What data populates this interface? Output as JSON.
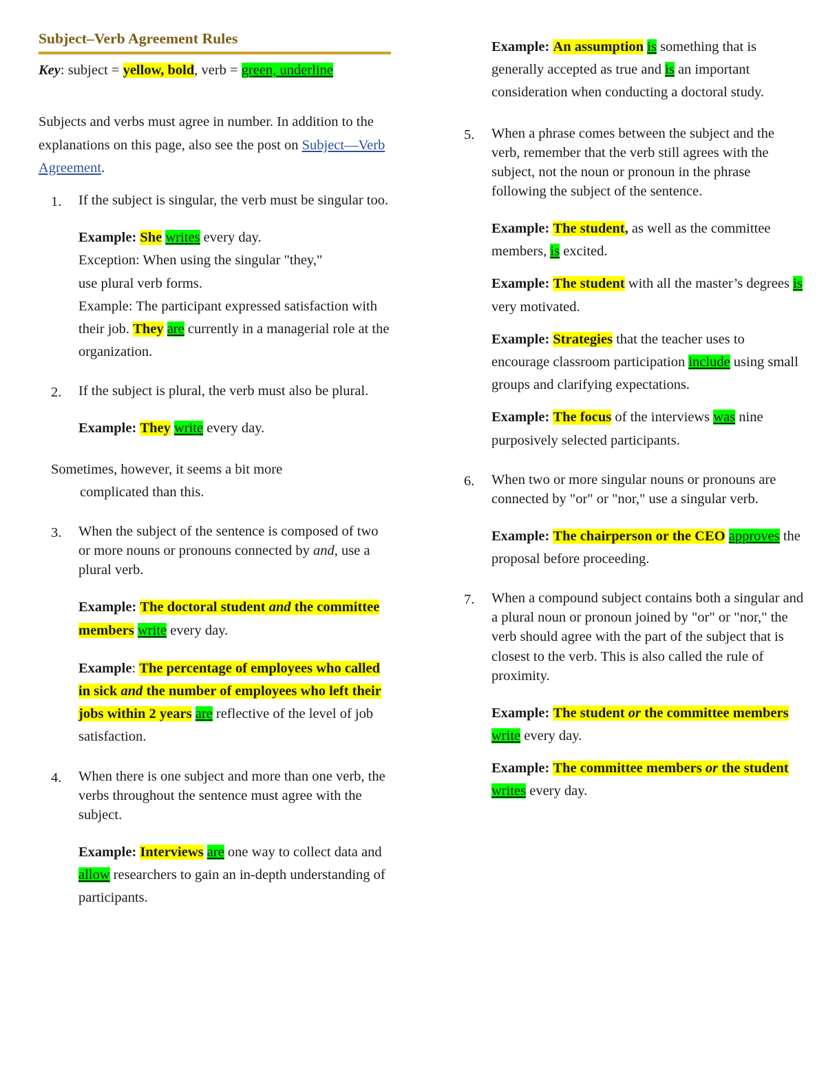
{
  "document": {
    "title": "Subject–Verb Agreement Rules",
    "accent_rule_color": "#cf9f28",
    "title_color": "#7a5c12",
    "subject_highlight_color": "#FFFF00",
    "verb_highlight_color": "#00FF00",
    "link_color": "#2b4f9e"
  },
  "key": {
    "label": "Key",
    "text_before": ": subject = ",
    "subject_sample": "yellow, bold",
    "text_middle": ", verb = ",
    "verb_sample": "green, underline"
  },
  "intro": {
    "line1": "Subjects and verbs must agree in number. In addition",
    "line2": "to the explanations on this page, also see the post",
    "line3_prefix": "on ",
    "link_text": "Subject—Verb Agreement",
    "line3_suffix": "."
  },
  "rules": [
    {
      "number": "1.",
      "text": "If the subject is singular, the verb must be singular too.",
      "examples": [
        {
          "label": "Example:",
          "parts": [
            {
              "t": "She",
              "style": "subject"
            },
            {
              "t": " ",
              "style": "plain"
            },
            {
              "t": "writes",
              "style": "verb"
            },
            {
              "t": " every day.",
              "style": "plain"
            }
          ]
        }
      ],
      "exception_lines": [
        "Exception: When using the singular \"they,\"",
        "use plural verb forms."
      ],
      "exception_example": {
        "label": "Example:",
        "parts": [
          {
            "t": " The participant expressed satisfaction with their job. ",
            "style": "plain"
          },
          {
            "t": "They",
            "style": "subject"
          },
          {
            "t": " ",
            "style": "plain"
          },
          {
            "t": "are",
            "style": "verb"
          },
          {
            "t": " currently in a managerial role at the organization.",
            "style": "plain"
          }
        ]
      }
    },
    {
      "number": "2.",
      "text": "If the subject is plural, the verb must also be plural.",
      "examples": [
        {
          "label": "Example:",
          "parts": [
            {
              "t": "They",
              "style": "subject"
            },
            {
              "t": " ",
              "style": "plain"
            },
            {
              "t": "write",
              "style": "verb"
            },
            {
              "t": " every day.",
              "style": "plain"
            }
          ]
        }
      ]
    },
    {
      "number": "3.",
      "text_a": "When the subject of the sentence is composed of two or more nouns or pronouns connected by ",
      "text_italic": "and",
      "text_b": ", use a plural verb.",
      "examples": [
        {
          "label": "Example:",
          "parts": [
            {
              "t": "The doctoral student ",
              "style": "subject"
            },
            {
              "t": "and",
              "style": "subject-italic"
            },
            {
              "t": " the ",
              "style": "subject"
            },
            {
              "t": "committee members",
              "style": "subject"
            },
            {
              "t": " ",
              "style": "plain"
            },
            {
              "t": "write",
              "style": "verb"
            },
            {
              "t": " every day.",
              "style": "plain"
            }
          ]
        },
        {
          "label": "Example",
          "label_suffix": ":",
          "parts": [
            {
              "t": "The percentage of employees who called in sick ",
              "style": "subject"
            },
            {
              "t": "and",
              "style": "subject-italic"
            },
            {
              "t": " the number of employees who left their jobs within 2 years",
              "style": "subject"
            },
            {
              "t": " ",
              "style": "plain"
            },
            {
              "t": "are",
              "style": "verb"
            },
            {
              "t": " reflective of the level of job satisfaction.",
              "style": "plain"
            }
          ]
        }
      ]
    },
    {
      "number": "4.",
      "text": "When there is one subject and more than one verb, the verbs throughout the sentence must agree with the subject.",
      "examples": [
        {
          "label": "Example:",
          "parts": [
            {
              "t": "Interviews",
              "style": "subject"
            },
            {
              "t": " ",
              "style": "plain"
            },
            {
              "t": "are",
              "style": "verb"
            },
            {
              "t": " one way to collect data and ",
              "style": "plain"
            },
            {
              "t": "allow",
              "style": "verb"
            },
            {
              "t": " researchers to gain an in-depth understanding of participants.",
              "style": "plain"
            }
          ]
        }
      ]
    },
    {
      "number": "5.",
      "text": "When a phrase comes between the subject and the verb, remember that the verb still agrees with the subject, not the noun or pronoun in the phrase following the subject of the sentence.",
      "examples": [
        {
          "label": "Example:",
          "parts": [
            {
              "t": "The student",
              "style": "subject"
            },
            {
              "t": ",",
              "style": "bold"
            },
            {
              "t": " as well as the committee members, ",
              "style": "plain"
            },
            {
              "t": "is",
              "style": "verb"
            },
            {
              "t": " excited.",
              "style": "plain"
            }
          ]
        },
        {
          "label": "Example:",
          "parts": [
            {
              "t": "The student",
              "style": "subject"
            },
            {
              "t": " with all the master’s degrees ",
              "style": "plain"
            },
            {
              "t": "is",
              "style": "verb"
            },
            {
              "t": " very motivated.",
              "style": "plain"
            }
          ]
        },
        {
          "label": "Example:",
          "parts": [
            {
              "t": "Strategies",
              "style": "subject"
            },
            {
              "t": " that the teacher uses to encourage classroom participation ",
              "style": "plain"
            },
            {
              "t": "include",
              "style": "verb"
            },
            {
              "t": " using small groups and clarifying expectations.",
              "style": "plain"
            }
          ]
        },
        {
          "label": "Example:",
          "parts": [
            {
              "t": "The focus",
              "style": "subject"
            },
            {
              "t": " of the interviews ",
              "style": "plain"
            },
            {
              "t": "was",
              "style": "verb"
            },
            {
              "t": " nine purposively selected participants.",
              "style": "plain"
            }
          ]
        }
      ]
    },
    {
      "number": "6.",
      "text": "When two or more singular nouns or pronouns are connected by \"or\" or \"nor,\" use a singular verb.",
      "examples": [
        {
          "label": "Example:",
          "parts": [
            {
              "t": "The chairperson or the CEO",
              "style": "subject"
            },
            {
              "t": " ",
              "style": "plain"
            },
            {
              "t": "approves",
              "style": "verb"
            },
            {
              "t": " the proposal before proceeding.",
              "style": "plain"
            }
          ]
        }
      ]
    },
    {
      "number": "7.",
      "text": "When a compound subject contains both a singular and a plural noun or pronoun joined by \"or\" or \"nor,\" the verb should agree with the part of the subject that is closest to the verb. This is also called the rule of proximity.",
      "examples": [
        {
          "label": "Example:",
          "parts": [
            {
              "t": "The student ",
              "style": "subject"
            },
            {
              "t": "or",
              "style": "subject-italic"
            },
            {
              "t": " the committee members",
              "style": "subject"
            },
            {
              "t": " ",
              "style": "plain"
            },
            {
              "t": "write",
              "style": "verb"
            },
            {
              "t": " every day.",
              "style": "plain"
            }
          ]
        },
        {
          "label": "Example:",
          "parts": [
            {
              "t": "The committee members ",
              "style": "subject"
            },
            {
              "t": "or",
              "style": "subject-italic"
            },
            {
              "t": " the student",
              "style": "subject"
            },
            {
              "t": " ",
              "style": "plain"
            },
            {
              "t": "writes",
              "style": "verb"
            },
            {
              "t": " every day.",
              "style": "plain"
            }
          ]
        }
      ]
    }
  ],
  "aside": {
    "line1": "Sometimes, however, it seems a bit more",
    "line2": "complicated than this."
  },
  "lead_example_right": {
    "label": "Example:",
    "parts": [
      {
        "t": "An assumption",
        "style": "subject"
      },
      {
        "t": " ",
        "style": "plain"
      },
      {
        "t": "is",
        "style": "verb"
      },
      {
        "t": " something that is generally accepted as true and ",
        "style": "plain"
      },
      {
        "t": "is",
        "style": "verb"
      },
      {
        "t": " an important consideration when conducting a doctoral study.",
        "style": "plain"
      }
    ]
  }
}
